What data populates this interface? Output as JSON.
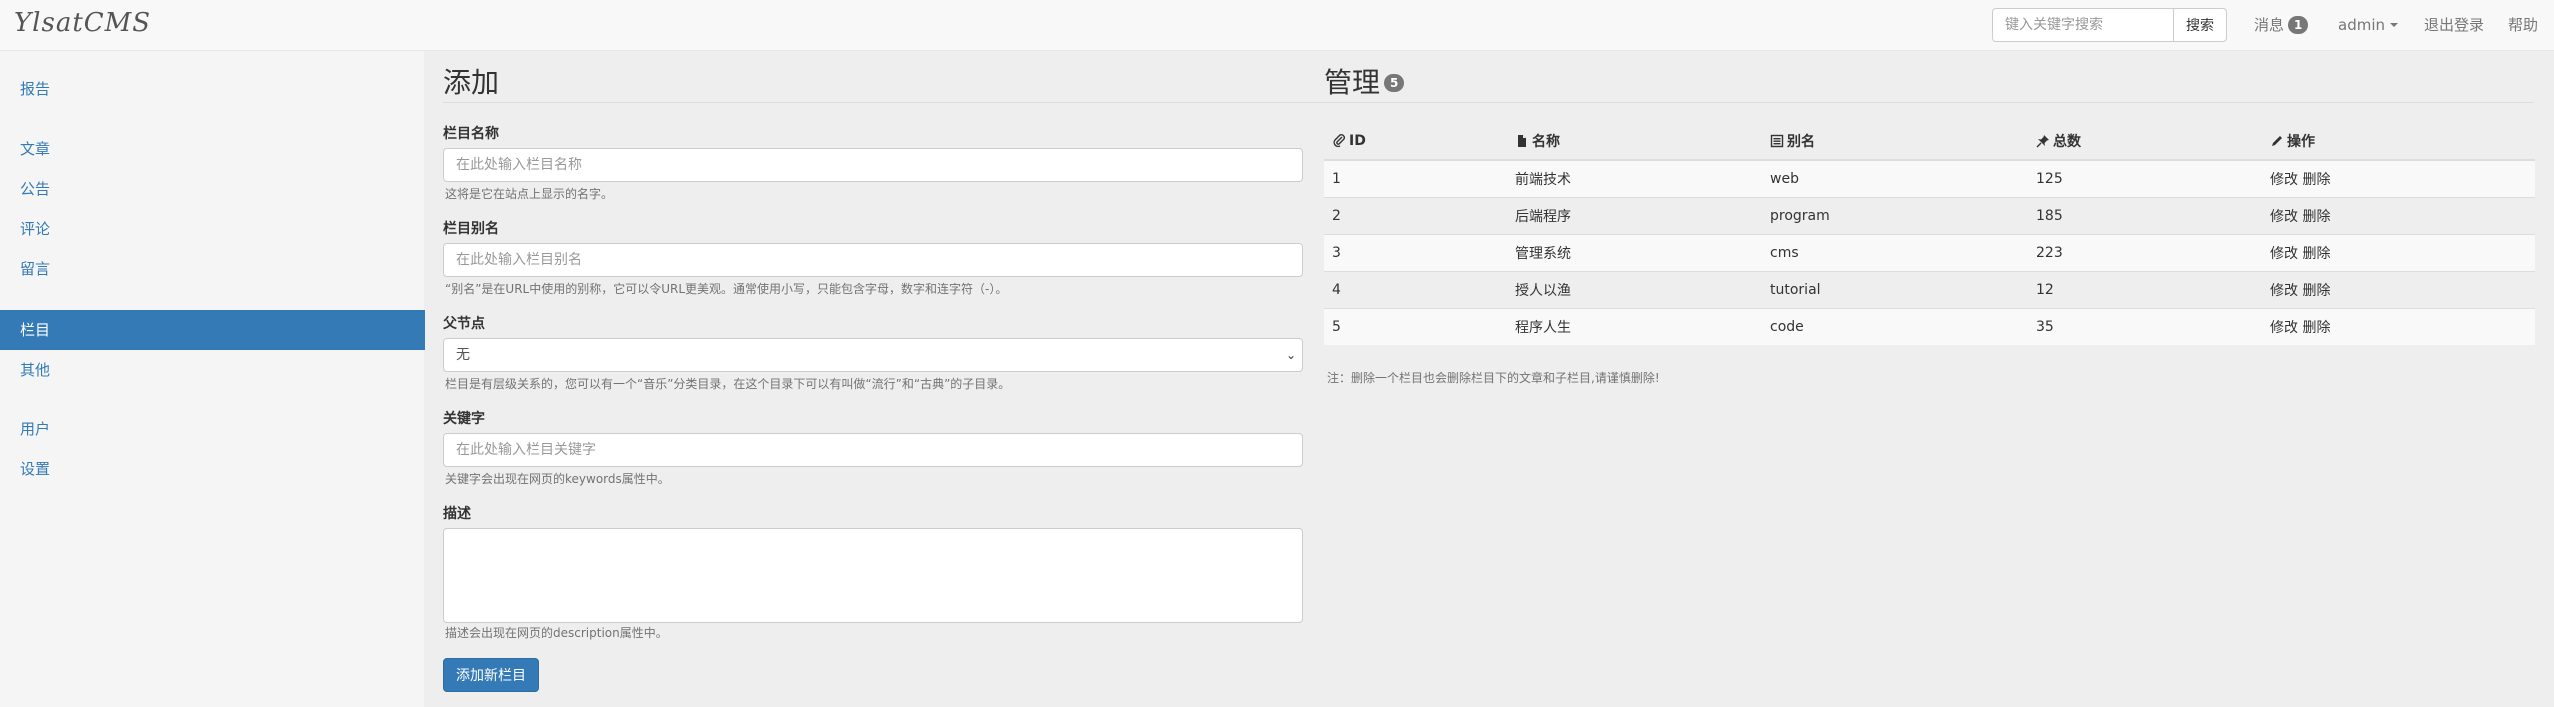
{
  "navbar": {
    "brand": "YlsatCMS",
    "search": {
      "placeholder": "键入关键字搜索",
      "button": "搜索"
    },
    "messages": {
      "label": "消息",
      "count": "1"
    },
    "user": "admin",
    "logout": "退出登录",
    "help": "帮助"
  },
  "sidebar": {
    "items": [
      {
        "label": "报告"
      },
      {
        "label": "文章"
      },
      {
        "label": "公告"
      },
      {
        "label": "评论"
      },
      {
        "label": "留言"
      },
      {
        "label": "栏目"
      },
      {
        "label": "其他"
      },
      {
        "label": "用户"
      },
      {
        "label": "设置"
      }
    ],
    "active_index": 5
  },
  "add_form": {
    "title": "添加",
    "name": {
      "label": "栏目名称",
      "placeholder": "在此处输入栏目名称",
      "help": "这将是它在站点上显示的名字。"
    },
    "alias": {
      "label": "栏目别名",
      "placeholder": "在此处输入栏目别名",
      "help": "“别名”是在URL中使用的别称，它可以令URL更美观。通常使用小写，只能包含字母，数字和连字符（-）。"
    },
    "parent": {
      "label": "父节点",
      "value": "无",
      "help": "栏目是有层级关系的，您可以有一个“音乐”分类目录，在这个目录下可以有叫做“流行”和“古典”的子目录。"
    },
    "keywords": {
      "label": "关键字",
      "placeholder": "在此处输入栏目关键字",
      "help": "关键字会出现在网页的keywords属性中。"
    },
    "description": {
      "label": "描述",
      "value": "",
      "help": "描述会出现在网页的description属性中。"
    },
    "submit": "添加新栏目"
  },
  "manage": {
    "title": "管理",
    "count": "5",
    "columns": [
      "ID",
      "名称",
      "别名",
      "总数",
      "操作"
    ],
    "column_icons": [
      "paperclip-icon",
      "file-icon",
      "list-alt-icon",
      "pushpin-icon",
      "pencil-icon"
    ],
    "rows": [
      {
        "id": "1",
        "name": "前端技术",
        "alias": "web",
        "total": "125",
        "edit": "修改",
        "delete": "删除"
      },
      {
        "id": "2",
        "name": "后端程序",
        "alias": "program",
        "total": "185",
        "edit": "修改",
        "delete": "删除"
      },
      {
        "id": "3",
        "name": "管理系统",
        "alias": "cms",
        "total": "223",
        "edit": "修改",
        "delete": "删除"
      },
      {
        "id": "4",
        "name": "授人以渔",
        "alias": "tutorial",
        "total": "12",
        "edit": "修改",
        "delete": "删除"
      },
      {
        "id": "5",
        "name": "程序人生",
        "alias": "code",
        "total": "35",
        "edit": "修改",
        "delete": "删除"
      }
    ],
    "note": "注：删除一个栏目也会删除栏目下的文章和子栏目,请谨慎删除!"
  },
  "colors": {
    "primary": "#337ab7",
    "badge": "#777777",
    "main_bg": "#eeeeee",
    "sidebar_bg": "#f5f5f5"
  }
}
